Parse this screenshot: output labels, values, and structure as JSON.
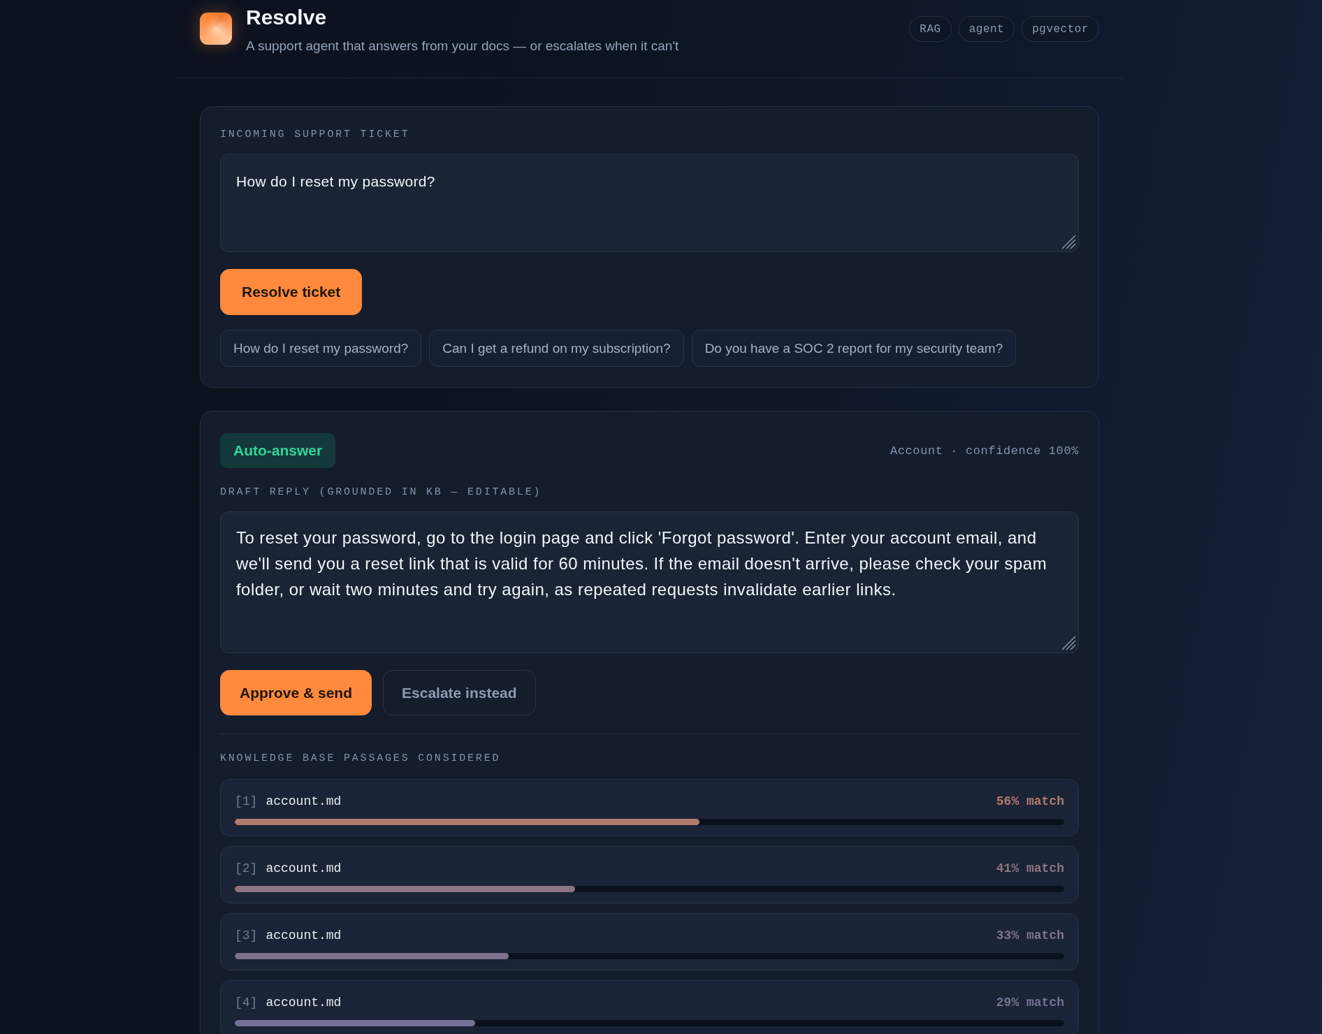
{
  "app": {
    "title": "Resolve",
    "subtitle": "A support agent that answers from your docs — or escalates when it can't",
    "tags": [
      "RAG",
      "agent",
      "pgvector"
    ]
  },
  "ticket": {
    "label": "INCOMING SUPPORT TICKET",
    "value": "How do I reset my password?",
    "submit": "Resolve ticket",
    "examples": [
      "How do I reset my password?",
      "Can I get a refund on my subscription?",
      "Do you have a SOC 2 report for my security team?"
    ]
  },
  "result": {
    "verdict": {
      "kind": "auto",
      "label": "Auto-answer"
    },
    "meta": "Account · confidence 100%",
    "draft_label": "DRAFT REPLY (GROUNDED IN KB — EDITABLE)",
    "draft": "To reset your password, go to the login page and click 'Forgot password'. Enter your account email, and we'll send you a reset link that is valid for 60 minutes. If the email doesn't arrive, please check your spam folder, or wait two minutes and try again, as repeated requests invalidate earlier links.",
    "actions": [
      {
        "kind": "primary",
        "label": "Approve & send"
      },
      {
        "kind": "secondary",
        "label": "Escalate instead"
      }
    ],
    "passages_label": "KNOWLEDGE BASE PASSAGES CONSIDERED",
    "passages": [
      {
        "index": "[1]",
        "source": "account.md",
        "match": "56% match",
        "level": 0.56,
        "color": "#b27a6b"
      },
      {
        "index": "[2]",
        "source": "account.md",
        "match": "41% match",
        "level": 0.41,
        "color": "#8d7480"
      },
      {
        "index": "[3]",
        "source": "account.md",
        "match": "33% match",
        "level": 0.33,
        "color": "#7d7390"
      },
      {
        "index": "[4]",
        "source": "account.md",
        "match": "29% match",
        "level": 0.29,
        "color": "#757196"
      }
    ]
  }
}
